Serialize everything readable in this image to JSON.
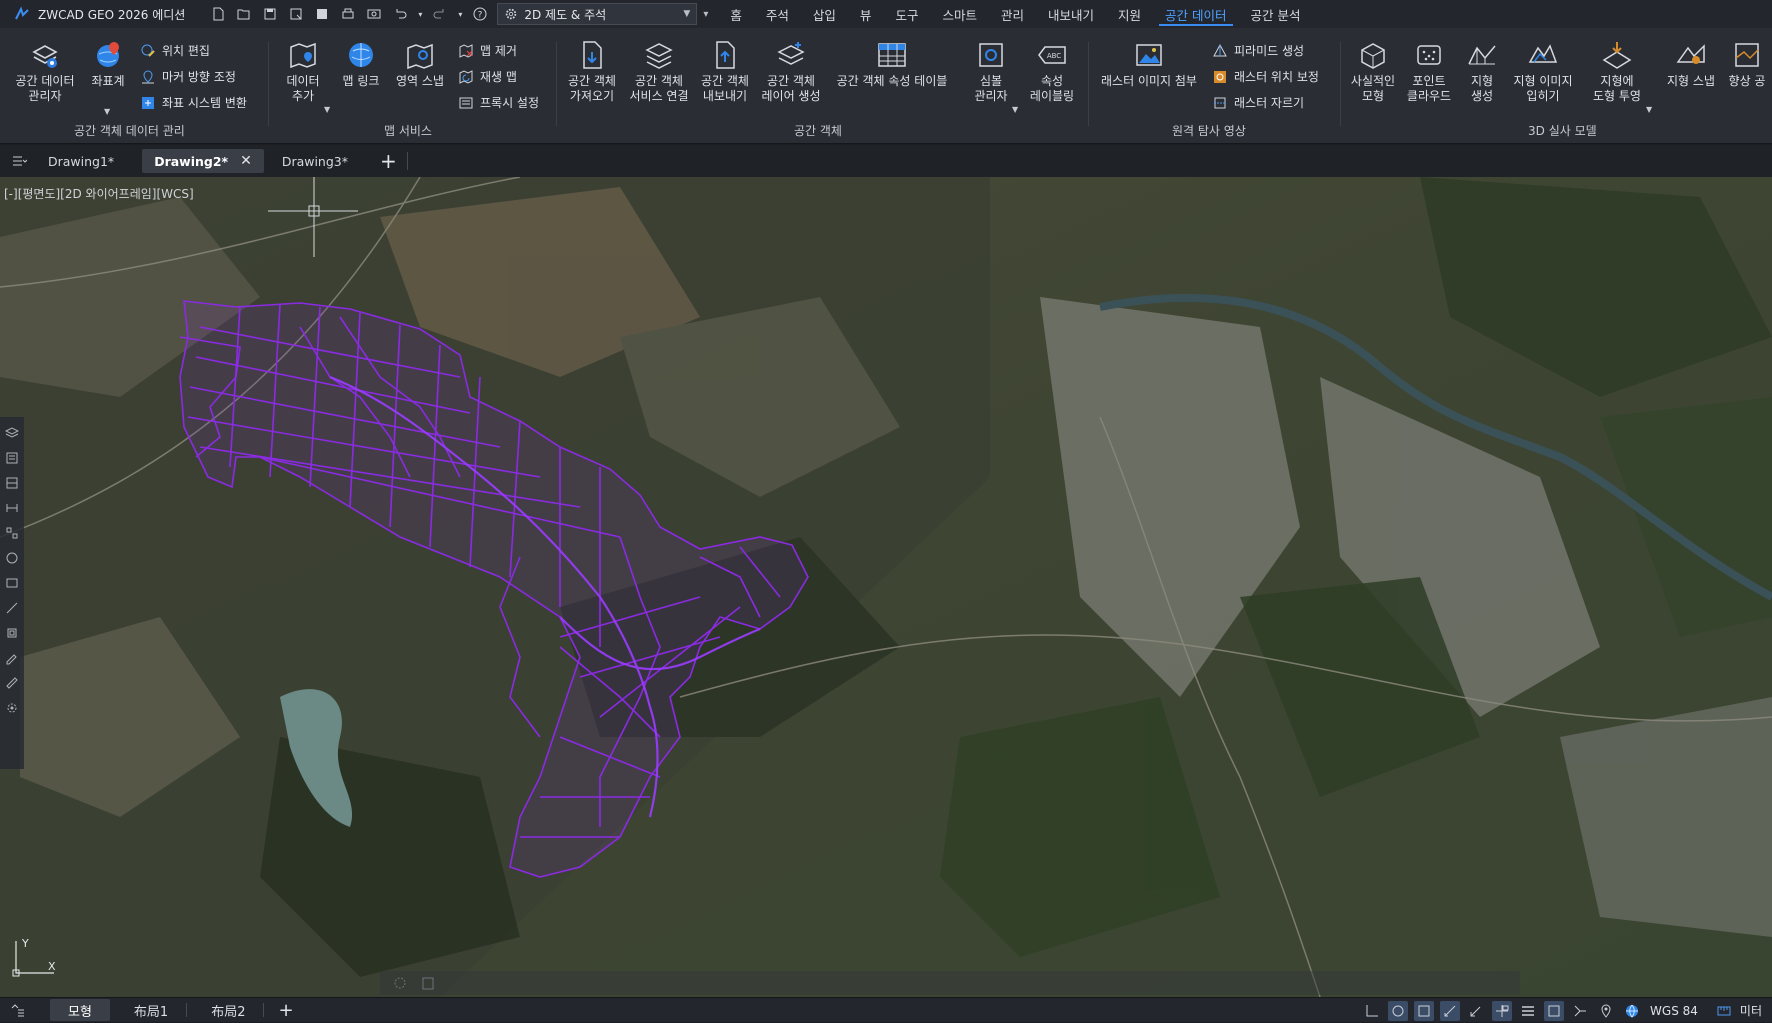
{
  "app": {
    "title": "ZWCAD GEO 2026 에디션",
    "workspace": "2D 제도 & 주석"
  },
  "menu": {
    "tabs": [
      "홈",
      "주석",
      "삽입",
      "뷰",
      "도구",
      "스마트",
      "관리",
      "내보내기",
      "지원",
      "공간 데이터",
      "공간 분석"
    ],
    "active": "공간 데이터"
  },
  "ribbon": {
    "groups": {
      "spatial_data_mgmt": {
        "label": "공간 객체 데이터 관리",
        "manager": "공간 데이터\n관리자",
        "crs": "좌표계",
        "edit_location": "위치 편집",
        "marker_direction": "마커 방향 조정",
        "crs_transform": "좌표 시스템 변환"
      },
      "map_service": {
        "label": "맵 서비스",
        "add_data": "데이터\n추가",
        "map_link": "맵 링크",
        "region_snap": "영역 스냅",
        "map_remove": "맵 제거",
        "regen_map": "재생 맵",
        "proxy_settings": "프록시 설정"
      },
      "spatial_object": {
        "label": "공간 객체",
        "import": "공간 객체\n가져오기",
        "service_connect": "공간 객체\n서비스 연결",
        "export": "공간 객체\n내보내기",
        "layer_create": "공간 객체\n레이어 생성",
        "attr_table": "공간 객체 속성 테이블",
        "symbol_manager": "심볼\n관리자",
        "attr_labeling": "속성\n레이블링"
      },
      "remote_sensing": {
        "label": "원격 탐사 영상",
        "attach_raster": "래스터 이미지 첨부",
        "pyramid": "피라미드 생성",
        "raster_georef": "래스터 위치 보정",
        "raster_clip": "래스터 자르기"
      },
      "model_3d": {
        "label": "3D 실사 모델",
        "realistic_model": "사실적인\n모형",
        "point_cloud": "포인트\n클라우드",
        "terrain_create": "지형\n생성",
        "terrain_drape": "지형 이미지\n입히기",
        "project_to_terrain": "지형에\n도형 투영",
        "terrain_snap": "지형 스냅",
        "improve_space": "향상 공"
      }
    }
  },
  "documents": {
    "tabs": [
      {
        "label": "Drawing1*",
        "active": false
      },
      {
        "label": "Drawing2*",
        "active": true
      },
      {
        "label": "Drawing3*",
        "active": false
      }
    ],
    "add_label": "+"
  },
  "viewport": {
    "label": "[-][평면도][2D 와이어프레임][WCS]",
    "ucs_y": "Y",
    "ucs_x": "X",
    "overlay_color": "#8a2be2"
  },
  "statusbar": {
    "layouts": [
      "모형",
      "布局1",
      "布局2"
    ],
    "active_layout": "모형",
    "add_label": "+",
    "coordinate_system": "WGS 84",
    "units": "미터"
  }
}
